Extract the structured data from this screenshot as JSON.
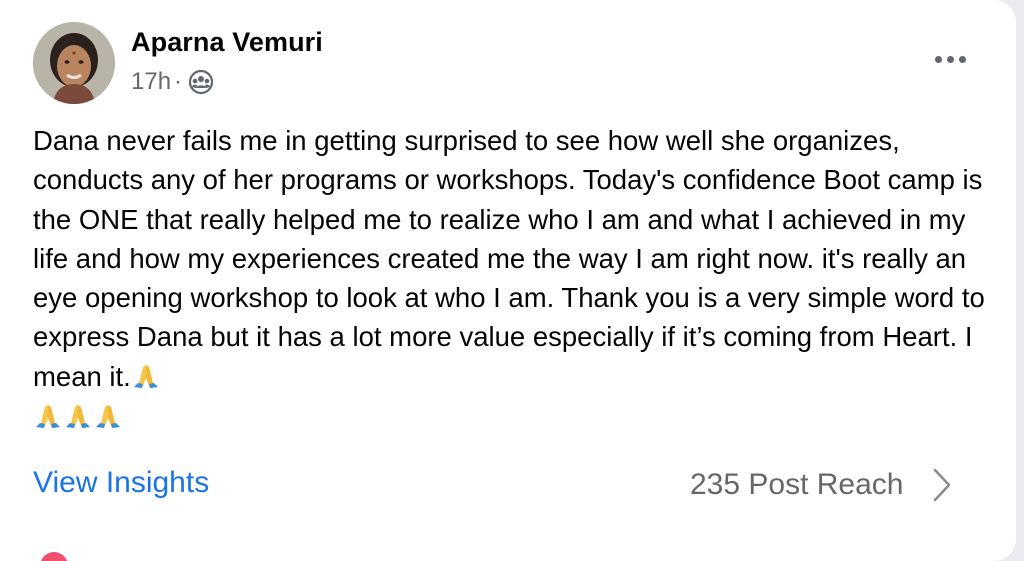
{
  "post": {
    "author": "Aparna Vemuri",
    "time": "17h",
    "separator": "·",
    "audience_icon": "friends-icon",
    "more_icon": "more-dots-icon",
    "body": "Dana never fails me in getting surprised to see how well she organizes, conducts any of her programs or workshops. Today's confidence Boot camp is the ONE that really helped me to realize who I am and what I achieved in my life and how my experiences created me the way I am right now. it's really an eye opening workshop to look at who I am. Thank you is a very simple word to express Dana but it has a lot more value especially if it’s coming from Heart. I mean it.",
    "trailing_emoji": "folded-hands",
    "emoji_count_line2": 3
  },
  "footer": {
    "insights_label": "View Insights",
    "reach_label": "235 Post Reach"
  },
  "colors": {
    "link": "#1b74e4",
    "secondary_text": "#65676b",
    "primary_text": "#050505"
  }
}
